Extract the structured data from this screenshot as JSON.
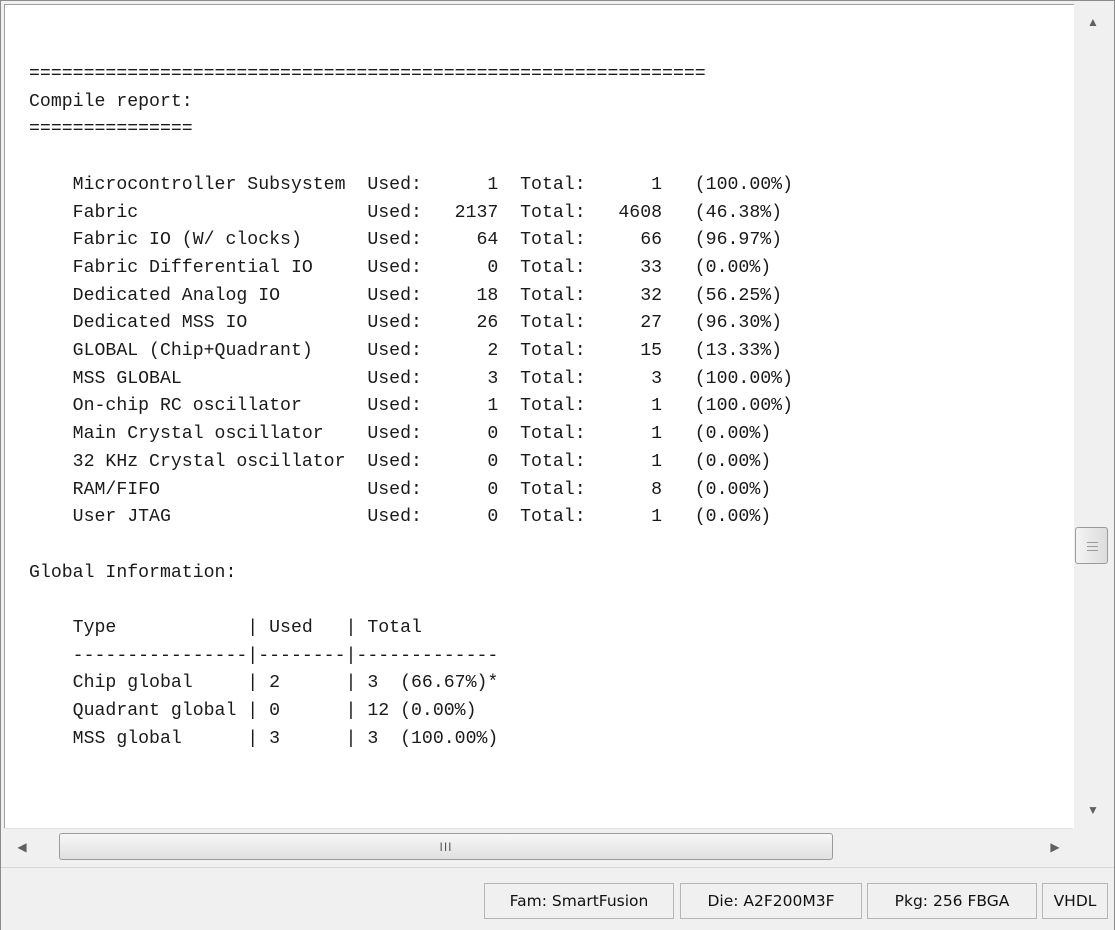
{
  "report": {
    "lines": [
      "==============================================================",
      "Compile report:",
      "===============",
      "",
      "    Microcontroller Subsystem  Used:      1  Total:      1   (100.00%)",
      "    Fabric                     Used:   2137  Total:   4608   (46.38%)",
      "    Fabric IO (W/ clocks)      Used:     64  Total:     66   (96.97%)",
      "    Fabric Differential IO     Used:      0  Total:     33   (0.00%)",
      "    Dedicated Analog IO        Used:     18  Total:     32   (56.25%)",
      "    Dedicated MSS IO           Used:     26  Total:     27   (96.30%)",
      "    GLOBAL (Chip+Quadrant)     Used:      2  Total:     15   (13.33%)",
      "    MSS GLOBAL                 Used:      3  Total:      3   (100.00%)",
      "    On-chip RC oscillator      Used:      1  Total:      1   (100.00%)",
      "    Main Crystal oscillator    Used:      0  Total:      1   (0.00%)",
      "    32 KHz Crystal oscillator  Used:      0  Total:      1   (0.00%)",
      "    RAM/FIFO                   Used:      0  Total:      8   (0.00%)",
      "    User JTAG                  Used:      0  Total:      1   (0.00%)",
      "",
      "Global Information:",
      "",
      "    Type            | Used   | Total",
      "    ----------------|--------|-------------",
      "    Chip global     | 2      | 3  (66.67%)*",
      "    Quadrant global | 0      | 12 (0.00%)",
      "    MSS global      | 3      | 3  (100.00%)"
    ]
  },
  "scrollbars": {
    "vertical": {
      "up_icon": "▲",
      "down_icon": "▼"
    },
    "horizontal": {
      "left_icon": "◀",
      "right_icon": "▶",
      "grip": "III"
    }
  },
  "statusbar": {
    "family": "Fam: SmartFusion",
    "die": "Die: A2F200M3F",
    "package": "Pkg: 256 FBGA",
    "language": "VHDL"
  }
}
